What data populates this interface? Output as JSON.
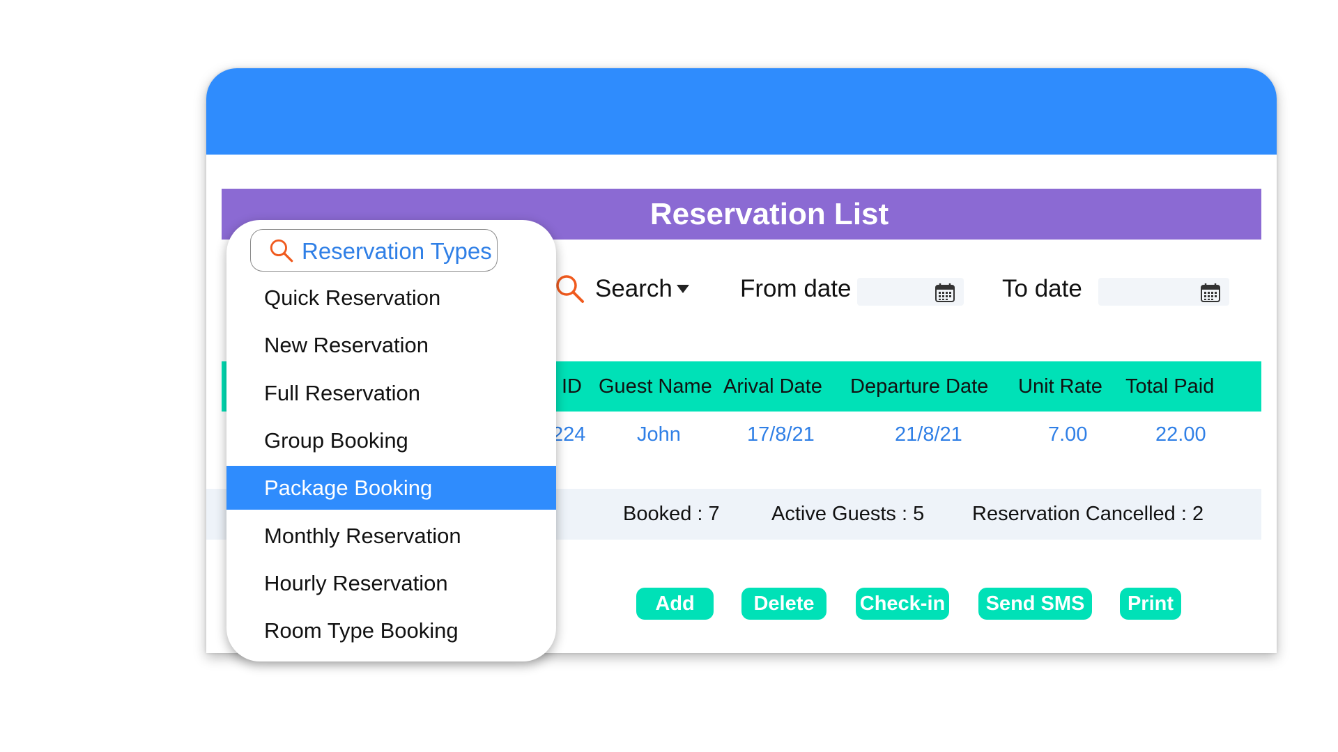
{
  "colors": {
    "header_blue": "#2f8cfd",
    "title_purple": "#8b6ad3",
    "teal": "#00e1b7",
    "link_blue": "#2f7fe6",
    "search_orange": "#f05a1e"
  },
  "title": "Reservation List",
  "toolbar": {
    "search_label": "Search",
    "from_date_label": "From date",
    "to_date_label": "To date",
    "from_date_value": "",
    "to_date_value": ""
  },
  "table": {
    "columns": [
      "ID",
      "Guest Name",
      "Arival Date",
      "Departure Date",
      "Unit Rate",
      "Total Paid"
    ],
    "rows": [
      [
        "224",
        "John",
        "17/8/21",
        "21/8/21",
        "7.00",
        "22.00"
      ]
    ]
  },
  "summary": {
    "booked": "Booked : 7",
    "active_guests": "Active Guests : 5",
    "cancelled": "Reservation Cancelled : 2"
  },
  "buttons": [
    "Add",
    "Delete",
    "Check-in",
    "Send SMS",
    "Print"
  ],
  "dropdown": {
    "search_placeholder": "Reservation Types",
    "items": [
      "Quick Reservation",
      "New Reservation",
      "Full Reservation",
      "Group Booking",
      "Package Booking",
      "Monthly Reservation",
      "Hourly Reservation",
      "Room Type Booking"
    ],
    "selected": "Package Booking"
  },
  "icons": {
    "search": "search-icon",
    "calendar": "calendar-icon",
    "caret": "caret-down-icon"
  }
}
